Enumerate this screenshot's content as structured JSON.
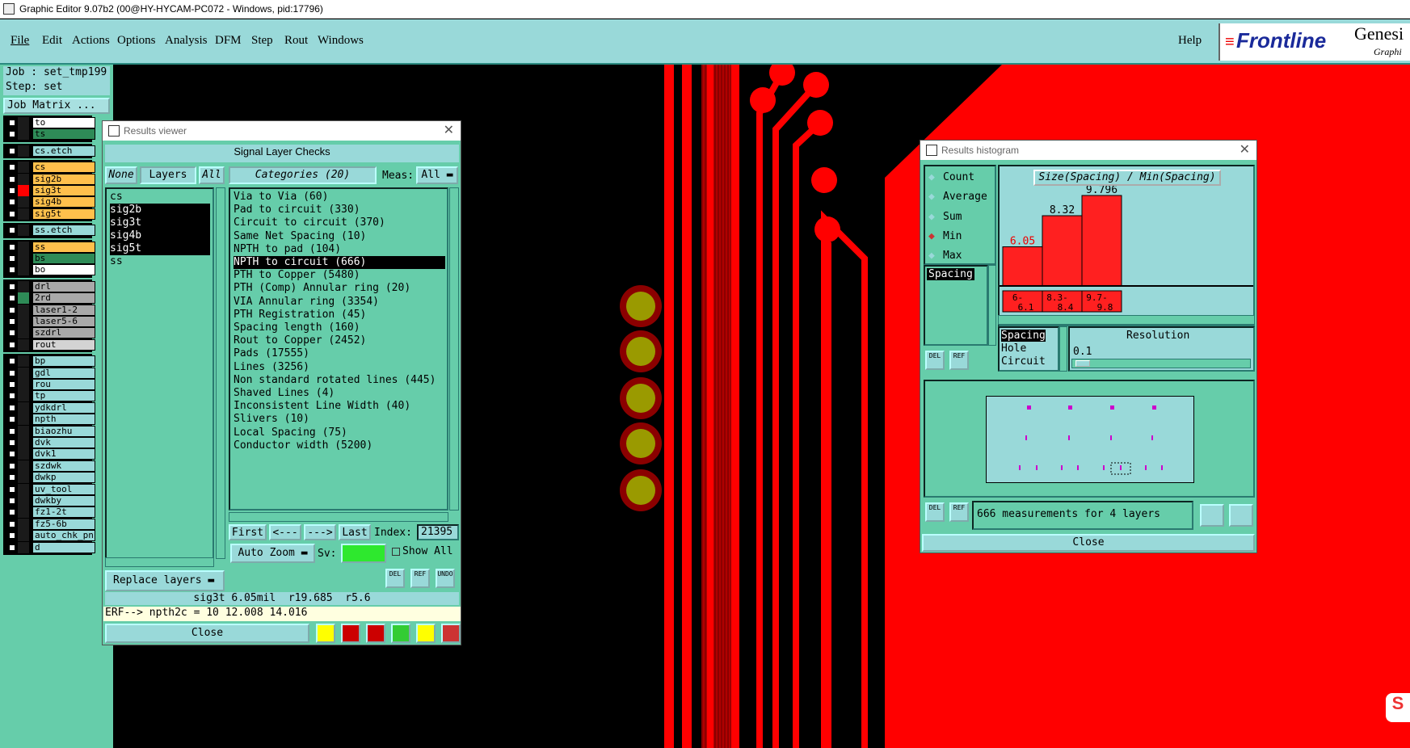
{
  "window": {
    "title": "Graphic Editor 9.07b2 (00@HY-HYCAM-PC072 - Windows, pid:17796)"
  },
  "menu": {
    "items": [
      "File",
      "Edit",
      "Actions",
      "Options",
      "Analysis",
      "DFM",
      "Step",
      "Rout",
      "Windows"
    ],
    "help": "Help",
    "logo_text": "Frontline",
    "brand": "Genesi",
    "brand_sub": "Graphi"
  },
  "job": {
    "job_label": "Job : set_tmp199",
    "step_label": "Step: set",
    "matrix_button": "Job Matrix ..."
  },
  "layers": [
    {
      "name": "to",
      "color": "#ffffff"
    },
    {
      "name": "ts",
      "color": "#2e8b57"
    },
    {
      "name": "cs.etch",
      "color": "#99d9d9"
    },
    {
      "name": "cs",
      "color": "#ffc04c"
    },
    {
      "name": "sig2b",
      "color": "#ffc04c"
    },
    {
      "name": "sig3t",
      "color": "#ffc04c"
    },
    {
      "name": "sig4b",
      "color": "#ffc04c"
    },
    {
      "name": "sig5t",
      "color": "#ffc04c"
    },
    {
      "name": "ss.etch",
      "color": "#99d9d9"
    },
    {
      "name": "ss",
      "color": "#ffc04c"
    },
    {
      "name": "bs",
      "color": "#2e8b57"
    },
    {
      "name": "bo",
      "color": "#ffffff"
    },
    {
      "name": "drl",
      "color": "#a9a9a9"
    },
    {
      "name": "2rd",
      "color": "#a9a9a9"
    },
    {
      "name": "laser1-2",
      "color": "#a9a9a9"
    },
    {
      "name": "laser5-6",
      "color": "#a9a9a9"
    },
    {
      "name": "szdrl",
      "color": "#a9a9a9"
    },
    {
      "name": "rout",
      "color": "#d3d3d3"
    },
    {
      "name": "bp",
      "color": "#99d9d9"
    },
    {
      "name": "gdl",
      "color": "#99d9d9"
    },
    {
      "name": "rou",
      "color": "#99d9d9"
    },
    {
      "name": "tp",
      "color": "#99d9d9"
    },
    {
      "name": "ydkdrl",
      "color": "#99d9d9"
    },
    {
      "name": "npth",
      "color": "#99d9d9"
    },
    {
      "name": "biaozhu",
      "color": "#99d9d9"
    },
    {
      "name": "dvk",
      "color": "#99d9d9"
    },
    {
      "name": "dvk1",
      "color": "#99d9d9"
    },
    {
      "name": "szdwk",
      "color": "#99d9d9"
    },
    {
      "name": "dwkp",
      "color": "#99d9d9"
    },
    {
      "name": "uv_tool",
      "color": "#99d9d9"
    },
    {
      "name": "dwkby",
      "color": "#99d9d9"
    },
    {
      "name": "fz1-2t",
      "color": "#99d9d9"
    },
    {
      "name": "fz5-6b",
      "color": "#99d9d9"
    },
    {
      "name": "auto_chk_pn",
      "color": "#99d9d9"
    },
    {
      "name": "d",
      "color": "#99d9d9"
    }
  ],
  "results_viewer": {
    "title": "Results viewer",
    "header": "Signal Layer Checks",
    "none_btn": "None",
    "layers_btn": "Layers",
    "all_btn": "All",
    "categories_btn": "Categories (20)",
    "meas_label": "Meas:",
    "meas_value": "All",
    "layer_list": [
      "cs",
      "sig2b",
      "sig3t",
      "sig4b",
      "sig5t",
      "ss"
    ],
    "categories": [
      "Via to Via (60)",
      "Pad to circuit (330)",
      "Circuit to circuit (370)",
      "Same Net Spacing (10)",
      "NPTH to pad (104)",
      "NPTH to circuit (666)",
      "PTH to Copper (5480)",
      "PTH (Comp) Annular ring (20)",
      "VIA Annular ring (3354)",
      "PTH Registration (45)",
      "Spacing length (160)",
      "Rout to Copper (2452)",
      "Pads (17555)",
      "Lines (3256)",
      "Non standard rotated lines (445)",
      "Shaved Lines (4)",
      "Inconsistent Line Width (40)",
      "Slivers (10)",
      "Local Spacing (75)",
      "Conductor width (5200)"
    ],
    "selected_category": "NPTH to circuit (666)",
    "nav": {
      "first": "First",
      "prev": "<---",
      "next": "--->",
      "last": "Last",
      "index_label": "Index:",
      "index_value": "21395"
    },
    "auto_zoom": "Auto Zoom",
    "sv_label": "Sv:",
    "show_all": "Show All",
    "replace_layers": "Replace layers",
    "icons": {
      "del": "DEL",
      "ref": "REF",
      "undo": "UNDO"
    },
    "status": "sig3t 6.05mil  r19.685  r5.6",
    "erf": "ERF--> npth2c = 10 12.008 14.016",
    "close": "Close"
  },
  "histogram": {
    "title": "Results histogram",
    "options": [
      "Count",
      "Average",
      "Sum",
      "Min",
      "Max"
    ],
    "selected_option": "Min",
    "chart_title": "Size(Spacing) / Min(Spacing)",
    "list_item": "Spacing",
    "measure_types": [
      "Spacing",
      "Hole",
      "Circuit"
    ],
    "resolution_label": "Resolution",
    "resolution_value": "0.1",
    "summary": "666 measurements for 4 layers",
    "close": "Close",
    "del": "DEL",
    "ref": "REF"
  },
  "chart_data": {
    "type": "bar",
    "title": "Size(Spacing) / Min(Spacing)",
    "categories": [
      "6-\n6.1",
      "8.3-\n8.4",
      "9.7-\n9.8"
    ],
    "values": [
      6.05,
      8.32,
      9.796
    ],
    "value_labels": [
      "6.05",
      "8.32",
      "9.796"
    ],
    "bar_color": "#ff2020"
  }
}
